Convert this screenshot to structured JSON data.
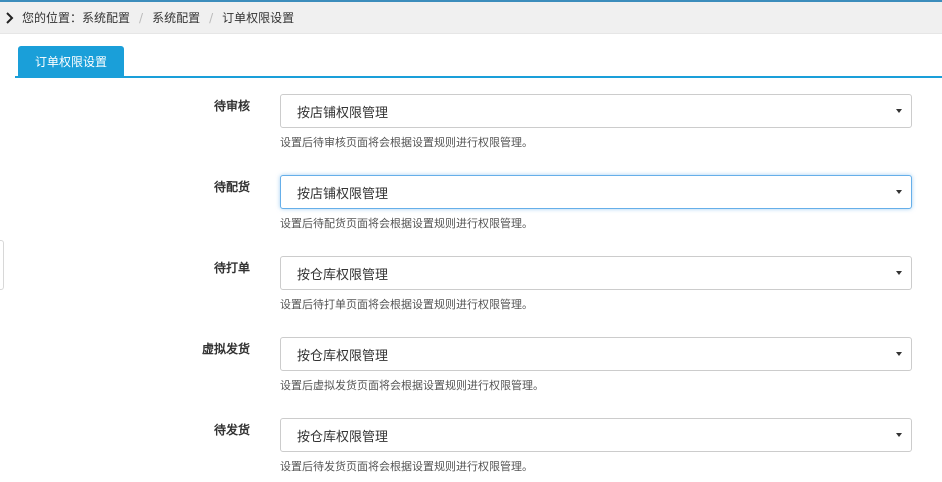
{
  "breadcrumb": {
    "prefix": "您的位置：",
    "items": [
      "系统配置",
      "系统配置",
      "订单权限设置"
    ],
    "chevron_icon": "chevron-right-icon"
  },
  "tab": {
    "label": "订单权限设置"
  },
  "rows": [
    {
      "label": "待审核",
      "value": "按店铺权限管理",
      "hint": "设置后待审核页面将会根据设置规则进行权限管理。"
    },
    {
      "label": "待配货",
      "value": "按店铺权限管理",
      "hint": "设置后待配货页面将会根据设置规则进行权限管理。"
    },
    {
      "label": "待打单",
      "value": "按仓库权限管理",
      "hint": "设置后待打单页面将会根据设置规则进行权限管理。"
    },
    {
      "label": "虚拟发货",
      "value": "按仓库权限管理",
      "hint": "设置后虚拟发货页面将会根据设置规则进行权限管理。"
    },
    {
      "label": "待发货",
      "value": "按仓库权限管理",
      "hint": "设置后待发货页面将会根据设置规则进行权限管理。"
    }
  ],
  "colors": {
    "accent": "#1a9fd9",
    "breadcrumb_bg": "#f0f0f0",
    "focus": "#66afe9"
  }
}
